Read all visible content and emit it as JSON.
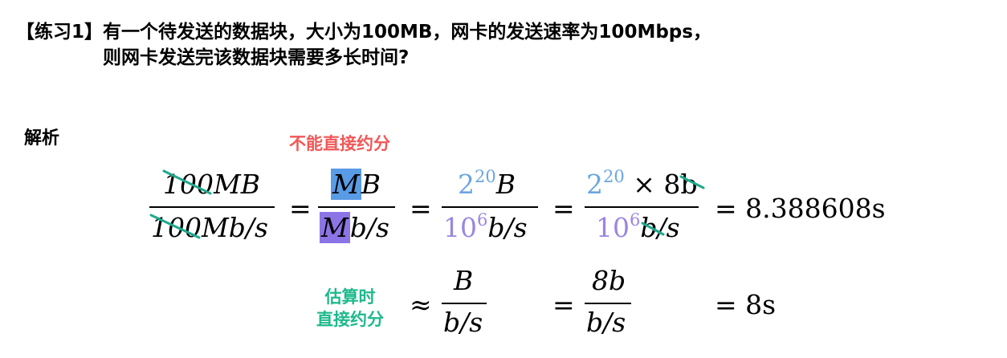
{
  "question": {
    "line1": "【练习1】有一个待发送的数据块，大小为100MB，网卡的发送速率为100Mbps，",
    "line2": "则网卡发送完该数据块需要多长时间?"
  },
  "analysis_label": "解析",
  "notes": {
    "no_cancel": "不能直接约分",
    "estimate_line1": "估算时",
    "estimate_line2": "直接约分"
  },
  "eq1": {
    "f1_num": "100MB",
    "f1_den": "100Mb/s",
    "op1": "=",
    "f2_num_hl": "M",
    "f2_num_rest": "B",
    "f2_den_hl": "M",
    "f2_den_rest": "b/s",
    "op2": "=",
    "f3_num_base": "2",
    "f3_num_exp": "20",
    "f3_num_unit": "B",
    "f3_den_base": "10",
    "f3_den_exp": "6",
    "f3_den_unit": "b/s",
    "op3": "=",
    "f4_num_base": "2",
    "f4_num_exp": "20",
    "f4_num_rest": " × 8b",
    "f4_den_base": "10",
    "f4_den_exp": "6",
    "f4_den_unit": "b/s",
    "result": "= 8.388608s"
  },
  "eq2": {
    "approx": "≈",
    "f1_num": "B",
    "f1_den": "b/s",
    "op": "=",
    "f2_num": "8b",
    "f2_den": "b/s",
    "result": "= 8s"
  },
  "colors": {
    "highlight_blue": "#5a9be6",
    "highlight_purple": "#8d74e6",
    "text_blue": "#6aa6e0",
    "text_purple": "#9a86e0",
    "red_note": "#f15757",
    "teal_note": "#1fb98c",
    "strike_teal": "#1fa98e"
  }
}
